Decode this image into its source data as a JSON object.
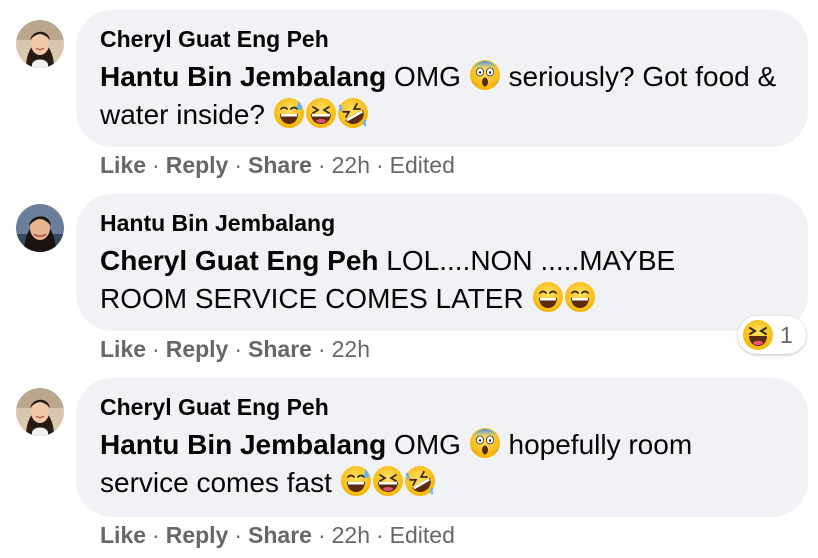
{
  "comments": [
    {
      "author": "Cheryl Guat Eng Peh",
      "mention": "Hantu Bin Jembalang",
      "text_parts": [
        "OMG",
        "seriously? Got food & water inside?"
      ],
      "emojis": [
        "screaming-face",
        "grinning-sweat",
        "grinning-squint",
        "rolling-laughing"
      ],
      "actions": {
        "like": "Like",
        "reply": "Reply",
        "share": "Share",
        "time": "22h",
        "edited": "Edited"
      }
    },
    {
      "author": "Hantu Bin Jembalang",
      "mention": "Cheryl Guat Eng Peh",
      "text_line1": "LOL....NON .....MAYBE",
      "text_line2": "ROOM SERVICE COMES LATER",
      "emojis": [
        "grinning-smile",
        "grinning-smile"
      ],
      "reaction": {
        "icon": "haha-reaction-icon",
        "count": "1"
      },
      "actions": {
        "like": "Like",
        "reply": "Reply",
        "share": "Share",
        "time": "22h"
      }
    },
    {
      "author": "Cheryl Guat Eng Peh",
      "mention": "Hantu Bin Jembalang",
      "text_parts": [
        "OMG",
        "hopefully room service comes fast"
      ],
      "emojis": [
        "screaming-face",
        "grinning-sweat",
        "grinning-squint",
        "rolling-laughing"
      ],
      "actions": {
        "like": "Like",
        "reply": "Reply",
        "share": "Share",
        "time": "22h",
        "edited": "Edited"
      }
    }
  ],
  "colors": {
    "bubble": "#f0f2f5",
    "meta_text": "#65676b",
    "emoji_yellow": "#fcc21b"
  }
}
